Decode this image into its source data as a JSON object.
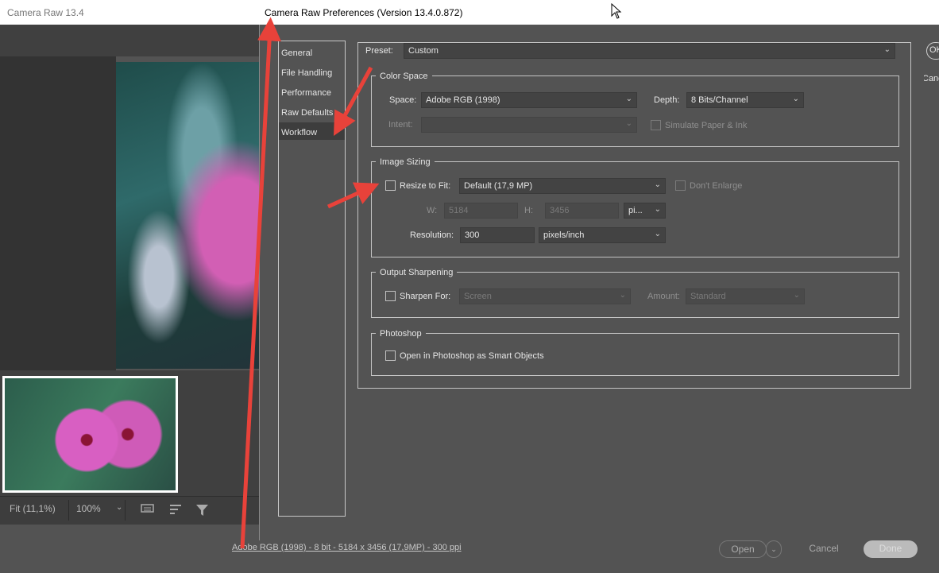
{
  "background_window": {
    "title": "Camera Raw 13.4",
    "zoom_fit": "Fit (11,1%)",
    "zoom_level": "100%",
    "status_line": "Adobe RGB (1998) - 8 bit - 5184 x 3456 (17,9MP) - 300 ppi",
    "buttons": {
      "open": "Open",
      "cancel": "Cancel",
      "done": "Done"
    }
  },
  "dialog": {
    "title": "Camera Raw Preferences  (Version 13.4.0.872)",
    "ok_label": "OK",
    "cancel_label": "Canc",
    "categories": [
      "General",
      "File Handling",
      "Performance",
      "Raw Defaults",
      "Workflow"
    ],
    "selected_category": "Workflow",
    "preset": {
      "label": "Preset:",
      "value": "Custom"
    },
    "color_space": {
      "legend": "Color Space",
      "space_label": "Space:",
      "space_value": "Adobe RGB (1998)",
      "depth_label": "Depth:",
      "depth_value": "8 Bits/Channel",
      "intent_label": "Intent:",
      "intent_value": "",
      "simulate_label": "Simulate Paper & Ink"
    },
    "image_sizing": {
      "legend": "Image Sizing",
      "resize_label": "Resize to Fit:",
      "resize_value": "Default  (17,9 MP)",
      "dont_enlarge_label": "Don't Enlarge",
      "w_label": "W:",
      "w_value": "5184",
      "h_label": "H:",
      "h_value": "3456",
      "unit_value": "pi...",
      "resolution_label": "Resolution:",
      "resolution_value": "300",
      "resolution_unit": "pixels/inch"
    },
    "output_sharpening": {
      "legend": "Output Sharpening",
      "sharpen_label": "Sharpen For:",
      "sharpen_value": "Screen",
      "amount_label": "Amount:",
      "amount_value": "Standard"
    },
    "photoshop": {
      "legend": "Photoshop",
      "smart_objects_label": "Open in Photoshop as Smart Objects"
    }
  },
  "colors": {
    "annotation_arrow": "#e8423a"
  }
}
